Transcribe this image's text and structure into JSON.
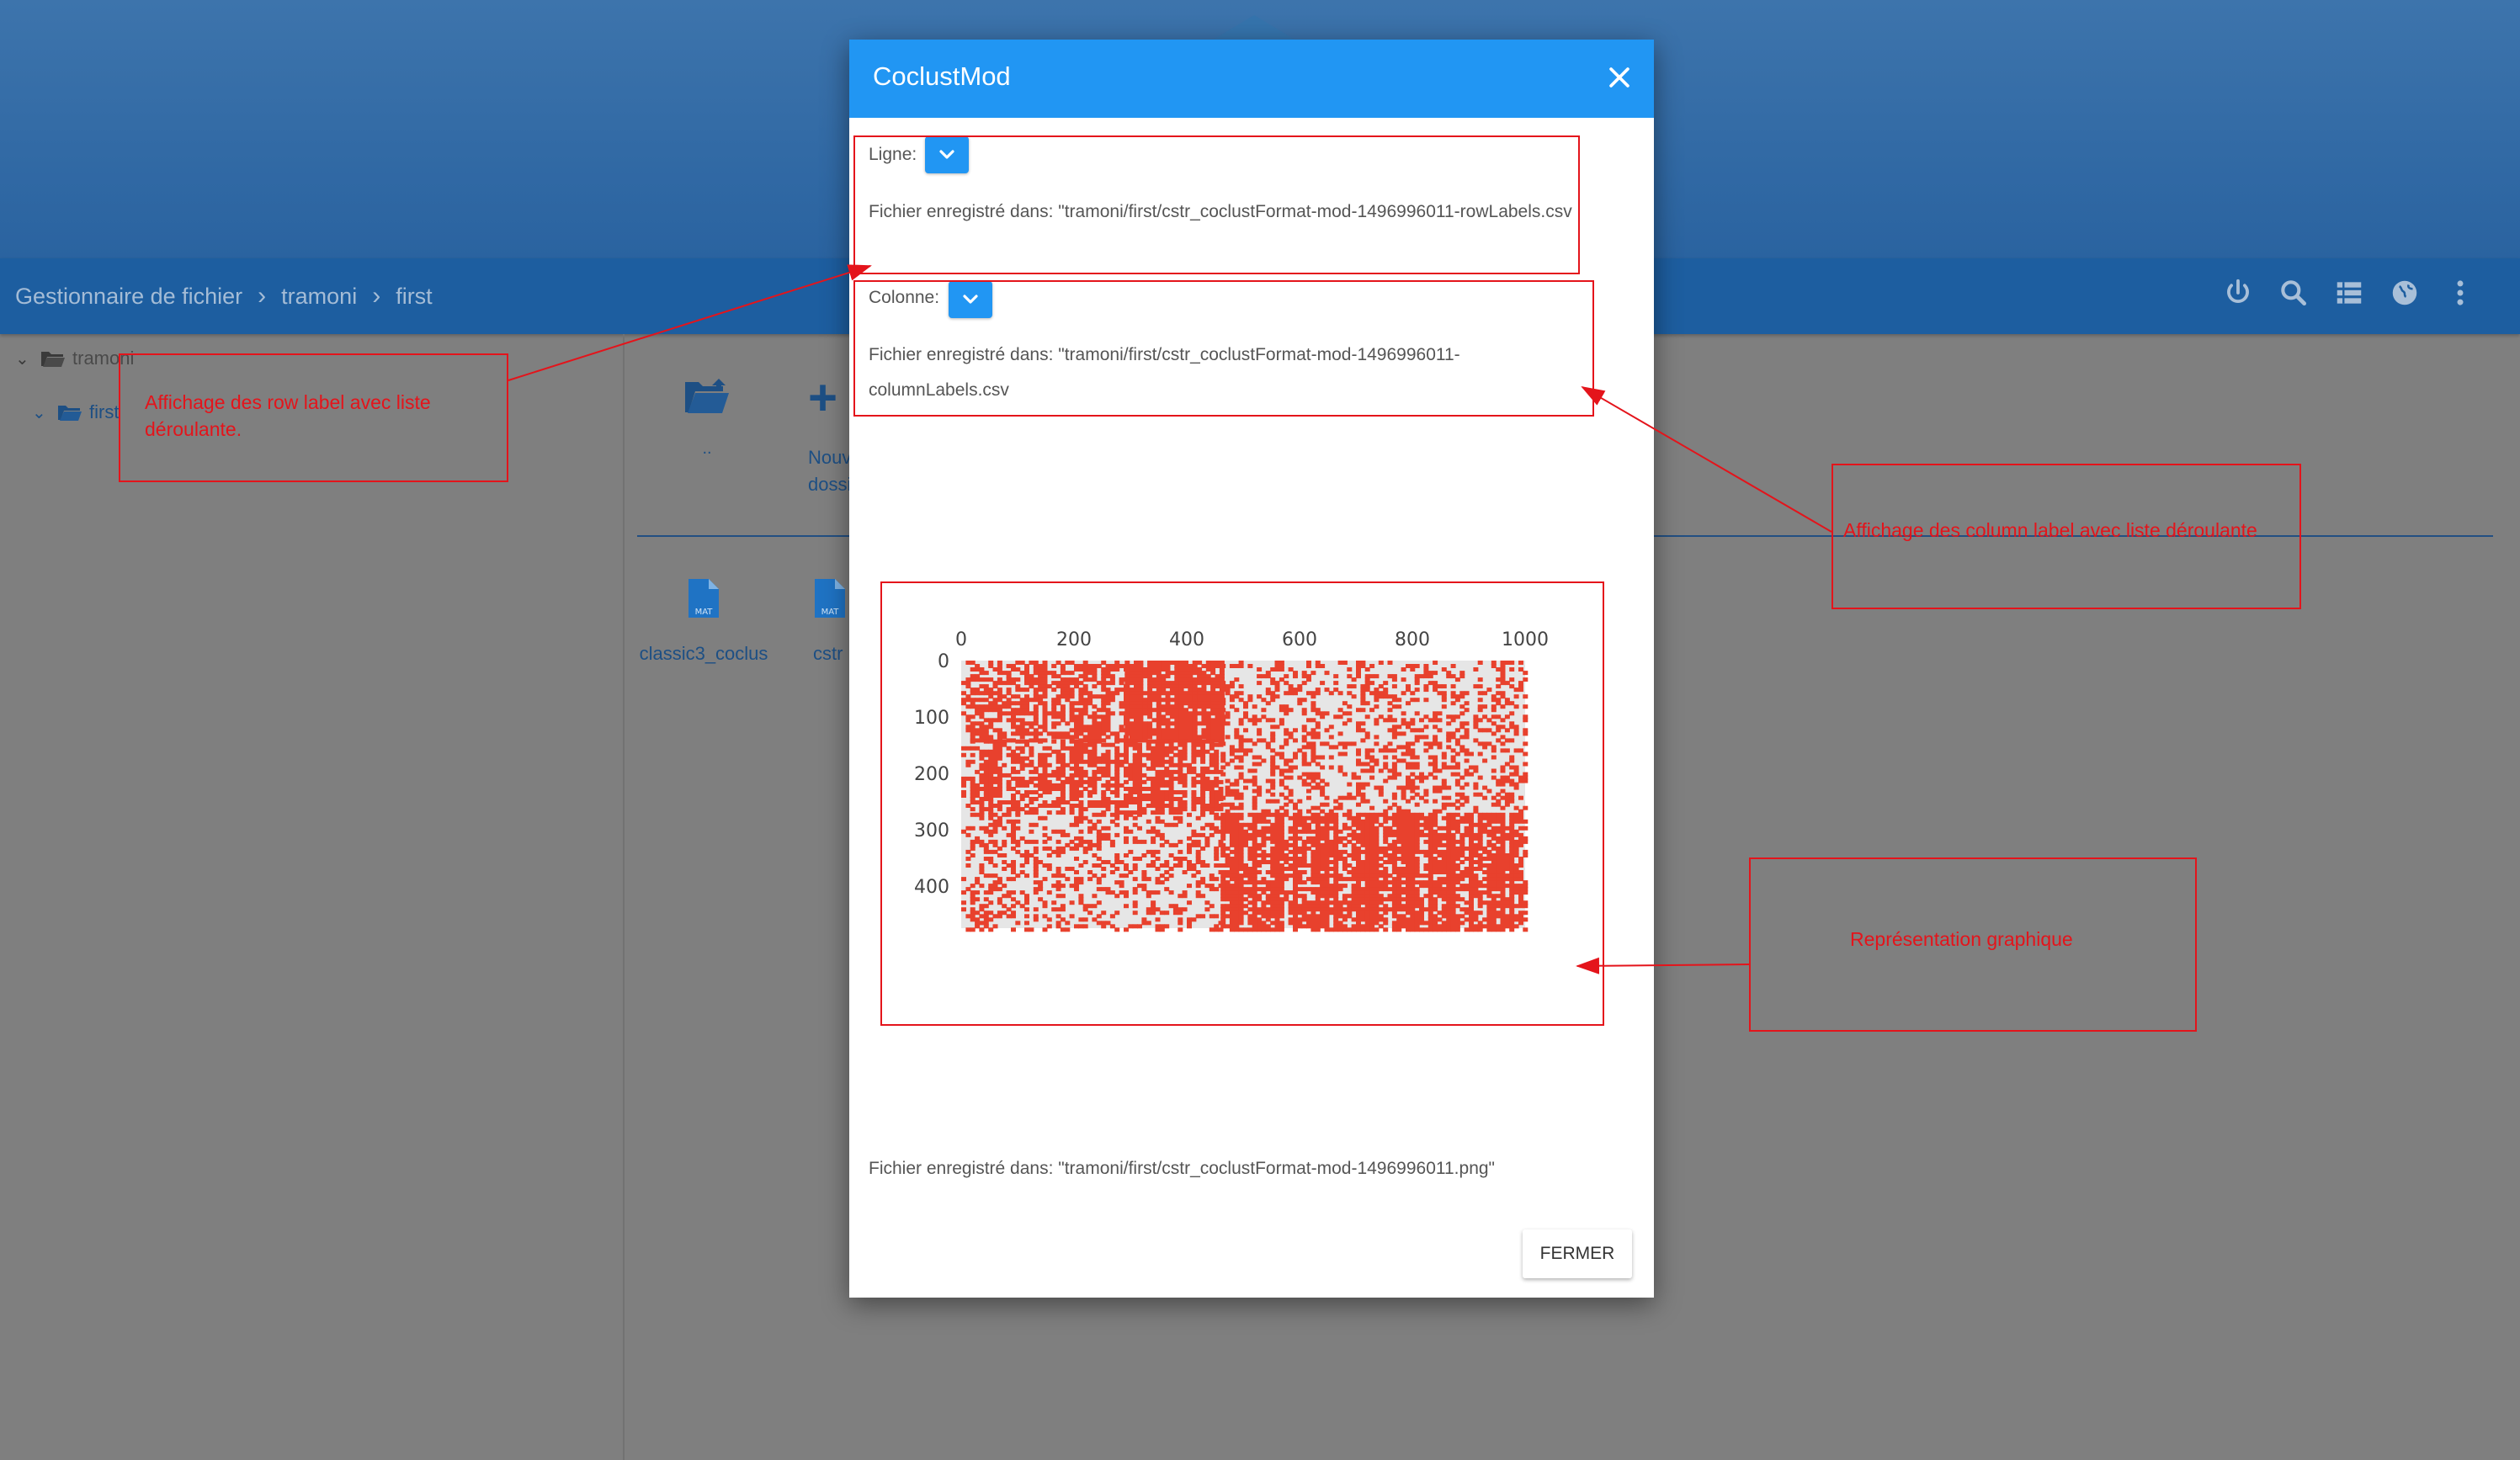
{
  "app": {
    "breadcrumb": [
      "Gestionnaire de fichier",
      "tramoni",
      "first"
    ],
    "toolbar_icons": [
      "power-icon",
      "search-icon",
      "list-view-icon",
      "globe-icon",
      "more-vert-icon"
    ]
  },
  "sidebar": {
    "tree": [
      {
        "label": "tramoni",
        "expanded": true
      },
      {
        "label": "first",
        "expanded": true
      }
    ]
  },
  "files": {
    "parent_label": "..",
    "new_folder_label": "Nouveau dossier",
    "items": [
      {
        "name": "classic3_coclus",
        "icon": "mat-file-icon",
        "badge": "MAT"
      },
      {
        "name": "cstr",
        "icon": "mat-file-icon",
        "badge": "MAT"
      }
    ]
  },
  "dialog": {
    "title": "CoclustMod",
    "row": {
      "label": "Ligne:",
      "saved_text": "Fichier enregistré dans: \"tramoni/first/cstr_coclustFormat-mod-1496996011-rowLabels.csv"
    },
    "col": {
      "label": "Colonne:",
      "saved_text": "Fichier enregistré dans: \"tramoni/first/cstr_coclustFormat-mod-1496996011-columnLabels.csv"
    },
    "image_saved_text": "Fichier enregistré dans: \"tramoni/first/cstr_coclustFormat-mod-1496996011.png\"",
    "close_button": "FERMER"
  },
  "chart_data": {
    "type": "heatmap",
    "title": "",
    "x_ticks": [
      0,
      200,
      400,
      600,
      800,
      1000
    ],
    "y_ticks": [
      0,
      100,
      200,
      300,
      400
    ],
    "xlim": [
      0,
      1000
    ],
    "ylim": [
      0,
      475
    ],
    "dot_color": "#e8412d",
    "background": "#e6e6e6",
    "dense_blocks": [
      {
        "cols": [
          290,
          460
        ],
        "rows": [
          0,
          140
        ],
        "density": 0.95
      },
      {
        "cols": [
          0,
          290
        ],
        "rows": [
          0,
          140
        ],
        "density": 0.55
      },
      {
        "cols": [
          0,
          460
        ],
        "rows": [
          140,
          270
        ],
        "density": 0.65
      },
      {
        "cols": [
          460,
          1000
        ],
        "rows": [
          270,
          475
        ],
        "density": 0.75
      },
      {
        "cols": [
          460,
          1000
        ],
        "rows": [
          0,
          270
        ],
        "density": 0.3
      },
      {
        "cols": [
          0,
          460
        ],
        "rows": [
          270,
          475
        ],
        "density": 0.3
      }
    ]
  },
  "annotations": [
    {
      "text": "Affichage des row label avec liste déroulante."
    },
    {
      "text": "Affichage des column label avec liste déroulante"
    },
    {
      "text": "Représentation graphique"
    }
  ],
  "colors": {
    "primary": "#2196f3",
    "toolbar": "#1d5ea0",
    "annotation": "#e4141b"
  }
}
